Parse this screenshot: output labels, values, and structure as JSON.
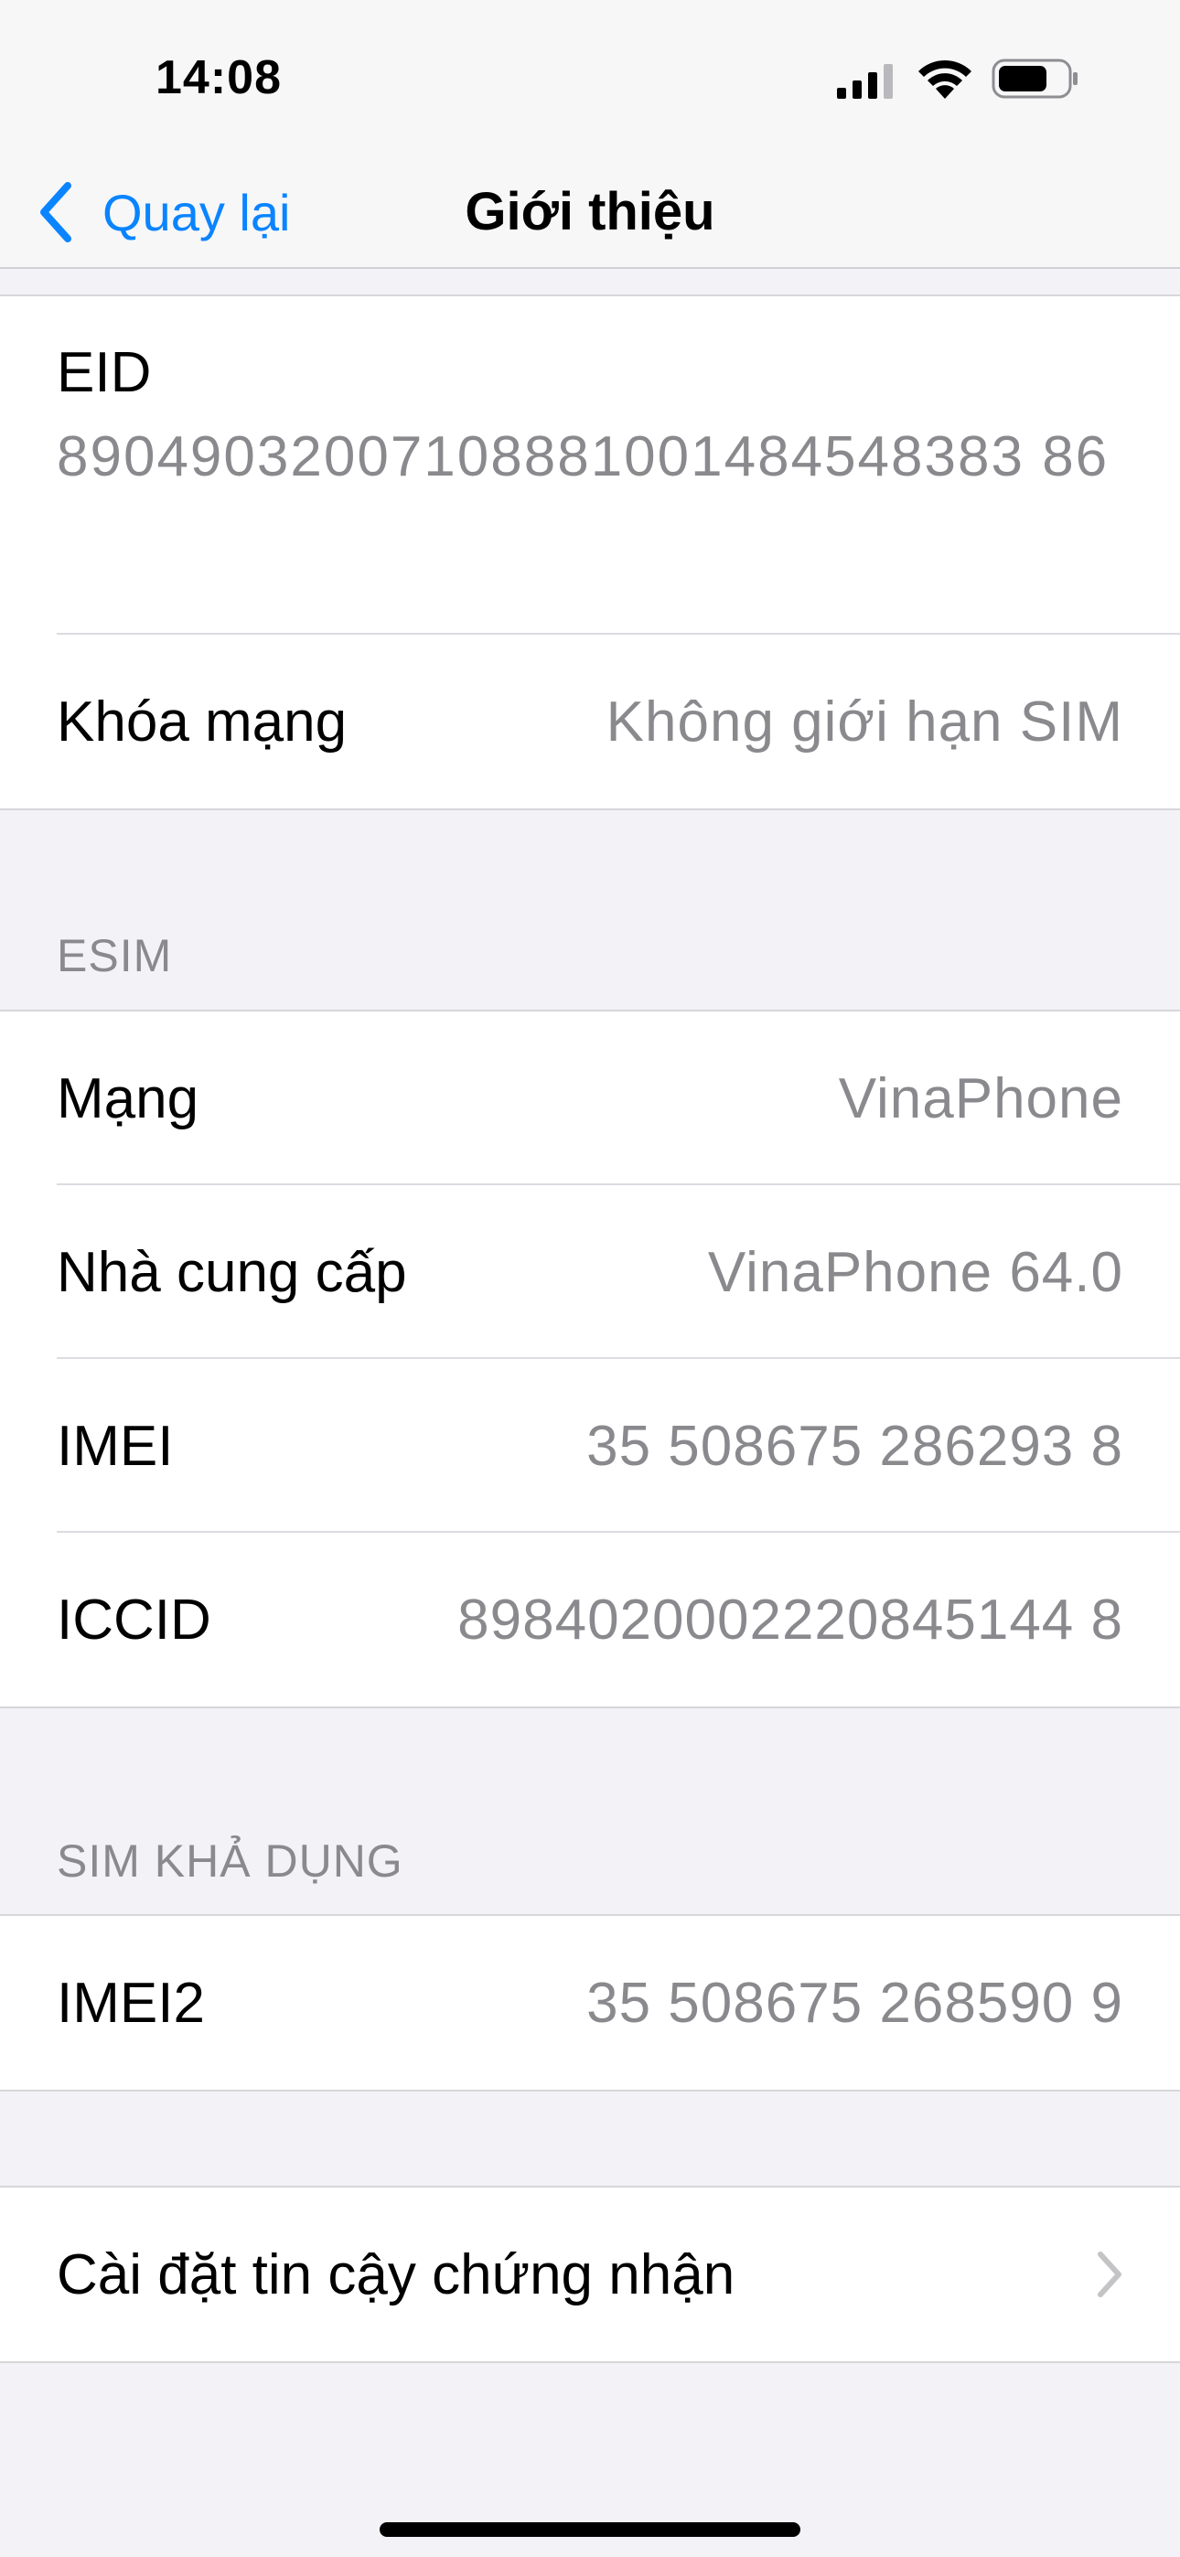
{
  "status_bar": {
    "time": "14:08",
    "icons": [
      "signal-icon",
      "wifi-icon",
      "battery-icon"
    ]
  },
  "nav": {
    "back_label": "Quay lại",
    "title": "Giới thiệu",
    "accent_color": "#0a84ff"
  },
  "device_group": {
    "eid_label": "EID",
    "eid_value": "89049032007108881001484548383 86",
    "lock_label": "Khóa mạng",
    "lock_value": "Không giới hạn SIM"
  },
  "esim_section": {
    "header": "ESIM",
    "rows": [
      {
        "label": "Mạng",
        "value": "VinaPhone"
      },
      {
        "label": "Nhà cung cấp",
        "value": "VinaPhone 64.0"
      },
      {
        "label": "IMEI",
        "value": "35 508675 286293 8"
      },
      {
        "label": "ICCID",
        "value": "8984020002220845144 8"
      }
    ]
  },
  "sim_section": {
    "header": "SIM KHẢ DỤNG",
    "rows": [
      {
        "label": "IMEI2",
        "value": "35 508675 268590 9"
      }
    ]
  },
  "cert_row": {
    "label": "Cài đặt tin cậy chứng nhận",
    "icon": "chevron-right-icon"
  }
}
